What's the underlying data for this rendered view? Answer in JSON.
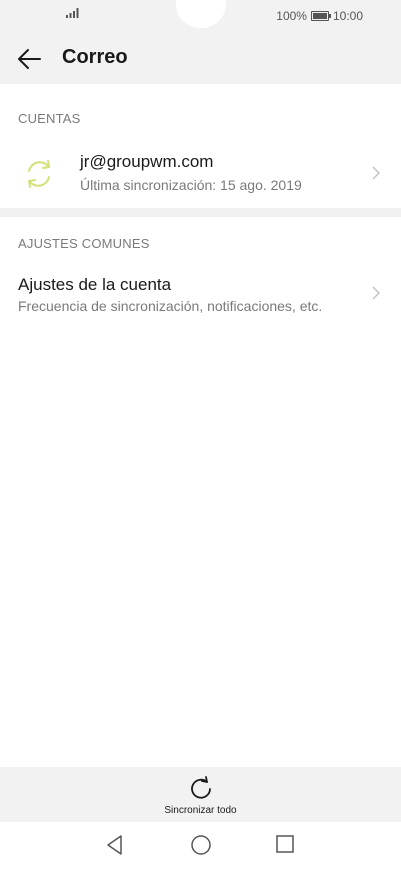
{
  "status_bar": {
    "battery": "100%",
    "time": "10:00"
  },
  "appbar": {
    "title": "Correo"
  },
  "accounts_section": {
    "header": "CUENTAS",
    "accounts": [
      {
        "email": "jr@groupwm.com",
        "last_sync": "Última sincronización: 15 ago. 2019"
      }
    ]
  },
  "common_settings_section": {
    "header": "AJUSTES COMUNES",
    "items": [
      {
        "title": "Ajustes de la cuenta",
        "subtitle": "Frecuencia de sincronización, notificaciones, etc."
      }
    ]
  },
  "bottom_bar": {
    "sync_all_label": "Sincronizar todo"
  },
  "icons": {
    "back": "arrow-left-icon",
    "account": "sync-icon",
    "chevron": "chevron-right-icon",
    "sync_all": "refresh-icon",
    "nav": [
      "nav-back-icon",
      "nav-home-icon",
      "nav-recents-icon"
    ]
  },
  "colors": {
    "account_icon": "#d6e07a",
    "bar_background": "#f2f2f2"
  }
}
